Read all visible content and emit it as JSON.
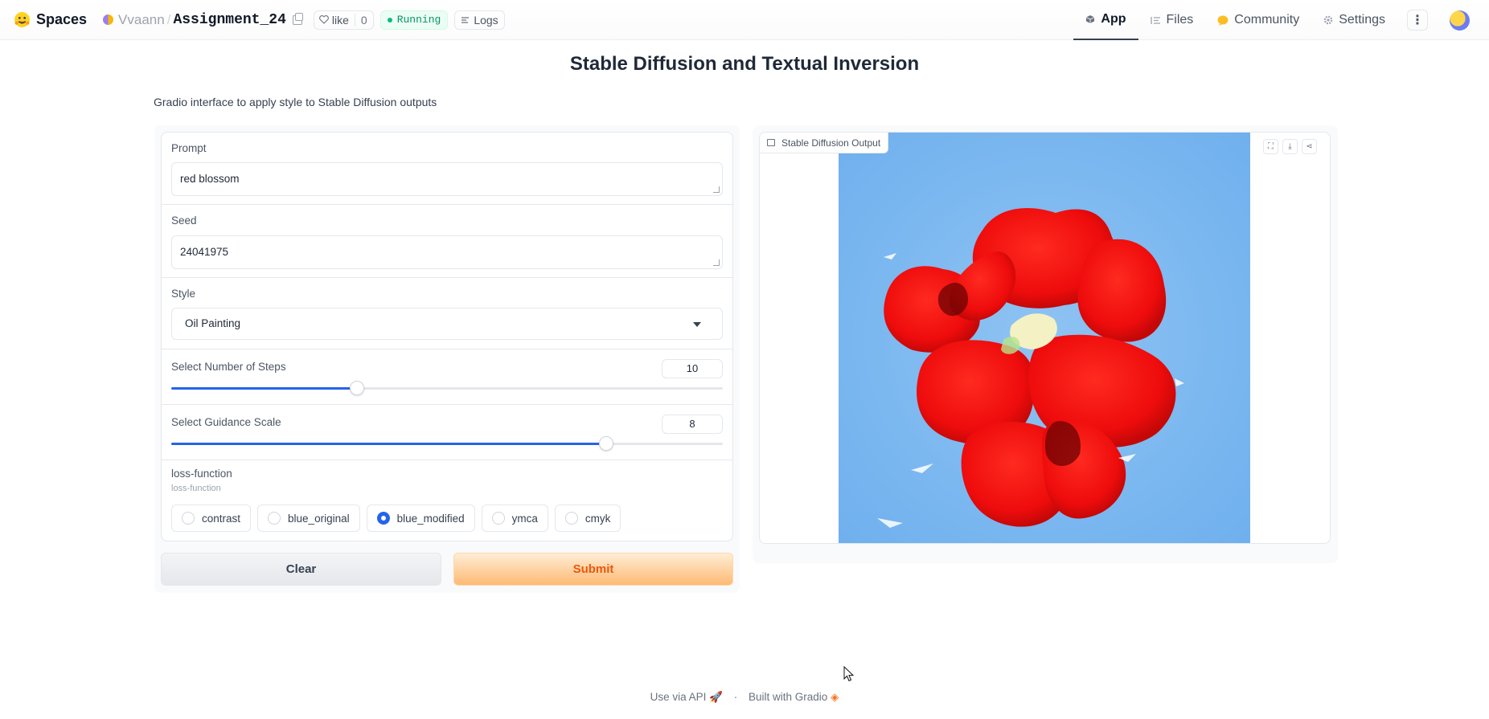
{
  "header": {
    "brand": "Spaces",
    "owner": "Vvaann",
    "repo": "Assignment_24",
    "like_label": "like",
    "like_count": "0",
    "status": "Running",
    "logs_label": "Logs",
    "nav": [
      {
        "label": "App",
        "icon": "cube-icon",
        "active": true
      },
      {
        "label": "Files",
        "icon": "files-icon",
        "active": false
      },
      {
        "label": "Community",
        "icon": "community-icon",
        "active": false
      },
      {
        "label": "Settings",
        "icon": "gear-icon",
        "active": false
      }
    ],
    "more_label": "⋮"
  },
  "app": {
    "title": "Stable Diffusion and Textual Inversion",
    "description": "Gradio interface to apply style to Stable Diffusion outputs",
    "prompt": {
      "label": "Prompt",
      "value": "red blossom"
    },
    "seed": {
      "label": "Seed",
      "value": "24041975"
    },
    "style": {
      "label": "Style",
      "value": "Oil Painting"
    },
    "steps": {
      "label": "Select Number of Steps",
      "value": "10",
      "fraction": 0.337
    },
    "guidance": {
      "label": "Select Guidance Scale",
      "value": "8",
      "fraction": 0.789
    },
    "loss": {
      "label": "loss-function",
      "info": "loss-function",
      "options": [
        "contrast",
        "blue_original",
        "blue_modified",
        "ymca",
        "cmyk"
      ],
      "selected": "blue_modified"
    },
    "buttons": {
      "clear": "Clear",
      "submit": "Submit"
    },
    "output_label": "Stable Diffusion Output"
  },
  "footer": {
    "api": "Use via API",
    "built": "Built with Gradio",
    "sep": "·"
  },
  "colors": {
    "accent": "#2563eb",
    "submit_text": "#ea580c",
    "running": "#059669"
  }
}
